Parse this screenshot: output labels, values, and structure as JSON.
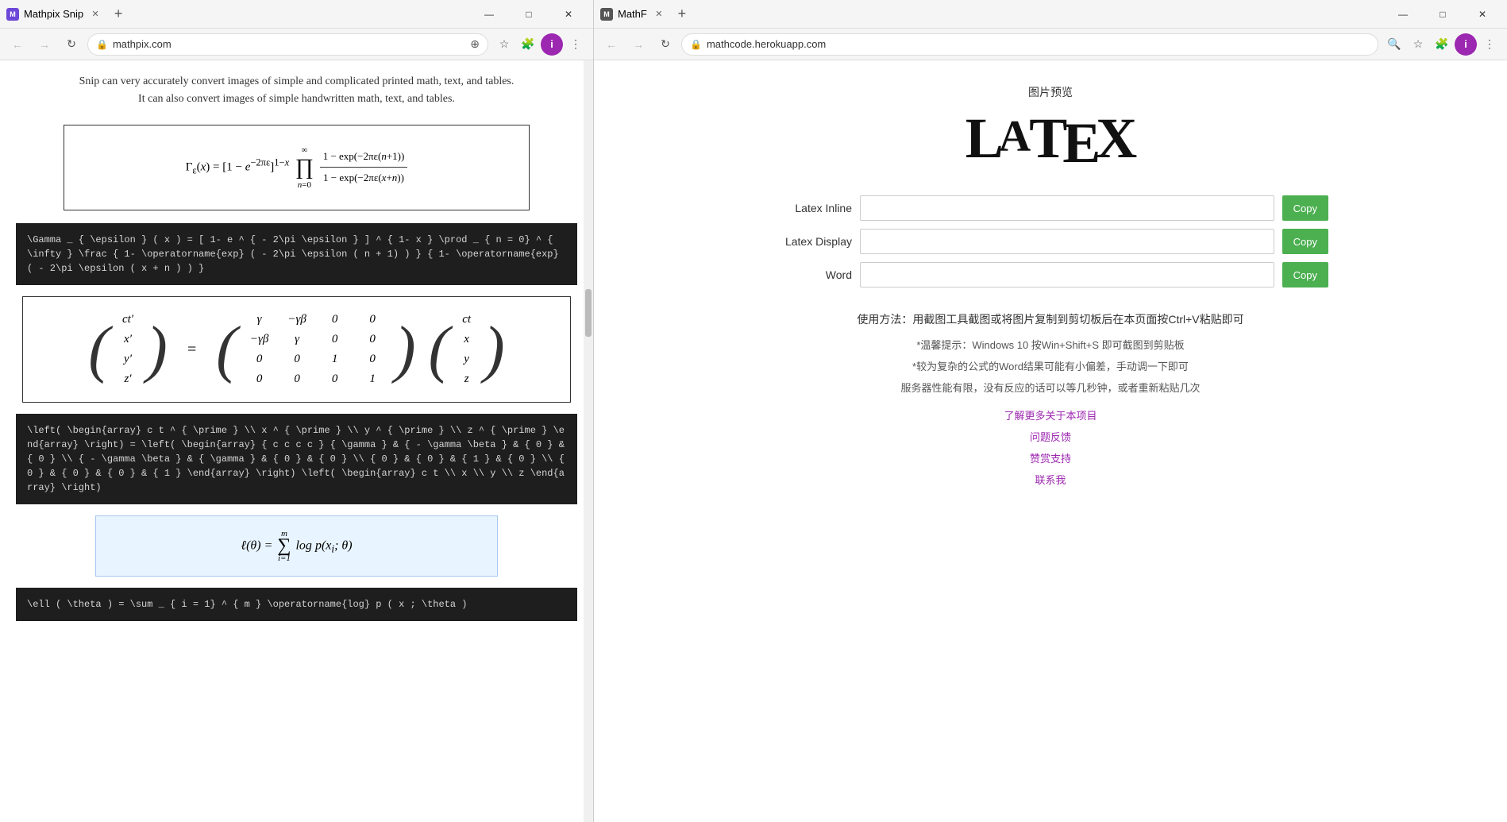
{
  "left_browser": {
    "title": "Mathpix Snip",
    "url": "mathpix.com",
    "tab_label": "Mathpix Snip",
    "favicon_letter": "M",
    "intro_lines": [
      "Snip can very accurately convert images of simple and complicated printed math, text, and tables.",
      "It can also convert images of simple handwritten math, text, and tables."
    ],
    "formula_image_alt": "Gamma product formula",
    "code_block_1": "\\Gamma _ { \\epsilon } ( x ) = [ 1- e ^ { - 2\\pi \\epsilon } ] ^ { 1- x } \\prod _ { n = 0} ^ { \\infty } \\frac { 1- \\operatorname{exp} ( - 2\\pi \\epsilon ( n + 1) ) } { 1- \\operatorname{exp} ( - 2\\pi \\epsilon ( x + n ) ) }",
    "code_block_2": "\\left( \\begin{array} c t ^ { \\prime } \\\\ x ^ { \\prime } \\\\ y ^ { \\prime } \\\\ z ^ { \\prime } \\end{array} \\right) = \\left( \\begin{array} { c c c c } { \\gamma } & { - \\gamma \\beta } & { 0 } & { 0 } \\\\ { - \\gamma \\beta } & { \\gamma } & { 0 } & { 0 } \\\\ { 0 } & { 0 } & { 1 } & { 0 } \\\\ { 0 } & { 0 } & { 0 } & { 1 } \\end{array} \\right) \\left( \\begin{array} c t \\\\ x \\\\ y \\\\ z \\end{array} \\right)",
    "code_block_3": "\\ell ( \\theta ) = \\sum _ { i = 1} ^ { m } \\operatorname{log} p ( x ; \\theta )"
  },
  "right_browser": {
    "title": "MathF",
    "url": "mathcode.herokuapp.com",
    "tab_label": "MathF",
    "favicon_letter": "M",
    "preview_label": "图片预览",
    "latex_logo": "LATEX",
    "form": {
      "rows": [
        {
          "label": "Latex Inline",
          "input_value": "",
          "button_label": "Copy"
        },
        {
          "label": "Latex Display",
          "input_value": "",
          "button_label": "Copy"
        },
        {
          "label": "Word",
          "input_value": "",
          "button_label": "Copy"
        }
      ]
    },
    "usage_main": "使用方法：用截图工具截图或将图片复制到剪切板后在本页面按Ctrl+V粘贴即可",
    "tips": [
      "*温馨提示：Windows 10 按Win+Shift+S 即可截图到剪贴板",
      "*较为复杂的公式的Word结果可能有小偏差，手动调一下即可",
      "服务器性能有限，没有反应的话可以等几秒钟，或者重新粘贴几次"
    ],
    "links": [
      "了解更多关于本项目",
      "问题反馈",
      "赞赏支持",
      "联系我"
    ]
  },
  "icons": {
    "back": "←",
    "forward": "→",
    "refresh": "↻",
    "lock": "🔒",
    "star": "☆",
    "extensions": "🧩",
    "menu": "⋮",
    "translate": "⊕",
    "close": "✕",
    "plus": "+"
  }
}
